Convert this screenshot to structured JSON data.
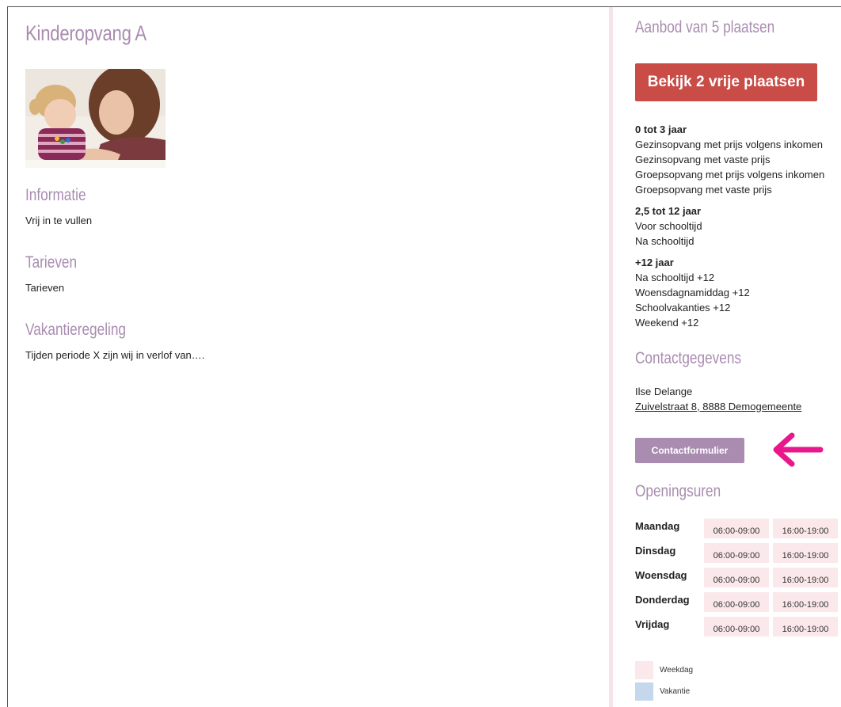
{
  "main": {
    "title": "Kinderopvang A",
    "photo_alt": "Moeder met kind",
    "sections": [
      {
        "title": "Informatie",
        "text": "Vrij in te vullen"
      },
      {
        "title": "Tarieven",
        "text": "Tarieven"
      },
      {
        "title": "Vakantieregeling",
        "text": "Tijden periode X zijn wij in verlof van…."
      }
    ]
  },
  "sidebar": {
    "offer_title": "Aanbod van 5 plaatsen",
    "cta_label": "Bekijk 2 vrije plaatsen",
    "groups": [
      {
        "title": "0 tot 3 jaar",
        "items": [
          "Gezinsopvang met prijs volgens inkomen",
          "Gezinsopvang met vaste prijs",
          "Groepsopvang met prijs volgens inkomen",
          "Groepsopvang met vaste prijs"
        ]
      },
      {
        "title": "2,5 tot 12 jaar",
        "items": [
          "Voor schooltijd",
          "Na schooltijd"
        ]
      },
      {
        "title": "+12 jaar",
        "items": [
          "Na schooltijd +12",
          "Woensdagnamiddag +12",
          "Schoolvakanties +12",
          "Weekend +12"
        ]
      }
    ],
    "contact_title": "Contactgegevens",
    "contact_name": "Ilse Delange",
    "contact_address": "Zuivelstraat 8, 8888 Demogemeente",
    "contact_button": "Contactformulier",
    "hours_title": "Openingsuren",
    "hours": [
      {
        "day": "Maandag",
        "slots": [
          "06:00-09:00",
          "16:00-19:00"
        ]
      },
      {
        "day": "Dinsdag",
        "slots": [
          "06:00-09:00",
          "16:00-19:00"
        ]
      },
      {
        "day": "Woensdag",
        "slots": [
          "06:00-09:00",
          "16:00-19:00"
        ]
      },
      {
        "day": "Donderdag",
        "slots": [
          "06:00-09:00",
          "16:00-19:00"
        ]
      },
      {
        "day": "Vrijdag",
        "slots": [
          "06:00-09:00",
          "16:00-19:00"
        ]
      }
    ],
    "legend": [
      {
        "label": "Weekdag",
        "color": "#fbe8eb"
      },
      {
        "label": "Vakantie",
        "color": "#c5d7ea"
      }
    ]
  },
  "colors": {
    "heading": "#a98cb0",
    "cta": "#c94c46",
    "annotation_arrow": "#e8188c"
  }
}
